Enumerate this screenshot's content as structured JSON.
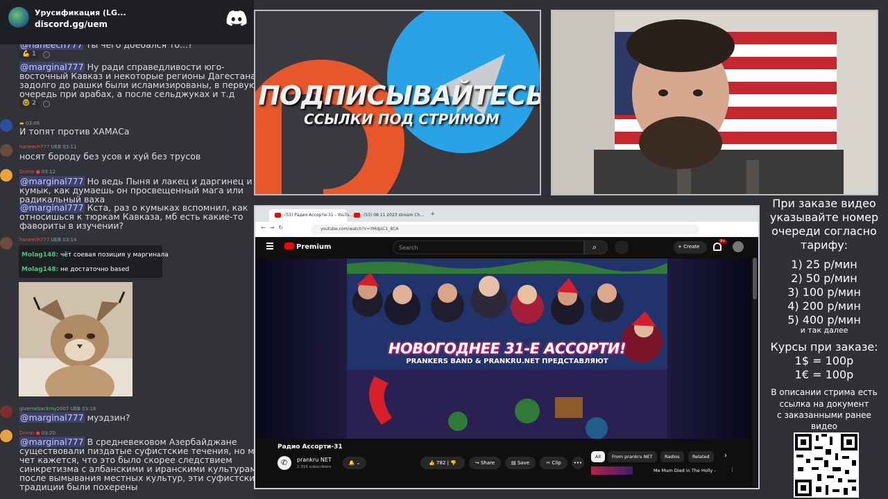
{
  "discord": {
    "server_name": "Урусификация (LG...",
    "invite": "discord.gg/uem"
  },
  "chat": {
    "m0_text": "ты чего доебался то...?",
    "m0_mention": "@haneech777",
    "m0_react": "1",
    "m1_mention": "@marginal777",
    "m1_lines": [
      "Ну ради справедливости юго-",
      "восточный Кавказ и некоторые регионы Дагестана",
      "задолго до рашки были исламизированы, в первую",
      "очередь при арабах, а после сельджуках и т.д"
    ],
    "m1_react": "2",
    "m2_time": "03:08",
    "m2_text": "И топят против ХАМАСа",
    "m3_user": "haneech777",
    "m3_badge": "UEB",
    "m3_time": "03:11",
    "m3_text": "носят бороду без усов и хуй без трусов",
    "m4_user": "Drimo",
    "m4_time": "03:12",
    "m4_mention": "@marginal777",
    "m4_lines": [
      "Но ведь Пыня и лакец и даргинец и",
      "кумык, как думаешь он просвещенный мага или",
      "радикальный ваха"
    ],
    "m5_mention": "@marginal777",
    "m5_lines": [
      "Кста, раз о кумыках вспомнил, как",
      "относишься к тюркам Кавказа, мб есть какие-то",
      "фавориты в изучении?"
    ],
    "m6_user": "haneech777",
    "m6_badge": "UEB",
    "m6_time": "03:14",
    "quote1_user": "Molag148:",
    "quote1_text": "чёт соевая позиция у маргинала",
    "quote2_user": "Molag148:",
    "quote2_text": "не достаточно based",
    "m7_user": "givemebackmy2007",
    "m7_badge": "UEB",
    "m7_time": "03:18",
    "m7_mention": "@marginal777",
    "m7_text": "муэдзин?",
    "m8_user": "Drimo",
    "m8_time": "03:20",
    "m8_mention": "@marginal777",
    "m8_lines": [
      "В средневековом Азербайджане",
      "существовали пиздатые суфистские течения, но мне",
      "чет кажется, что это было скорее следствием",
      "синкретизма с албанскими и иранскими культурами, и",
      "после вымывания местных культур, эти суфистские",
      "традиции были похерены"
    ]
  },
  "promo": {
    "title": "ПОДПИСЫВАЙТЕСЬ",
    "subtitle": "ССЫЛКИ ПОД СТРИМОМ"
  },
  "browser": {
    "tab1": "(53) Радио Ассорти-31 - YouTu...",
    "tab2": "(53) 08 11 2023 stream Ch...",
    "url": "youtube.com/watch?v=YMdpiC1_8CA",
    "logo": "Premium",
    "search_placeholder": "Search",
    "create": "Create",
    "notif_badge": "9+",
    "video_big_title": "НОВОГОДНЕЕ 31-Е АССОРТИ!",
    "video_sub_title": "PRANKERS BAND & PRANKRU.NET ПРЕДСТАВЛЯЮТ",
    "video_title": "Радио Ассорти-31",
    "channel": "prankru NET",
    "subscribers": "2.31K subscribers",
    "likes": "782",
    "share": "Share",
    "save": "Save",
    "clip": "Clip",
    "more": "•••",
    "chips": [
      "All",
      "From prankru NET",
      "Radios",
      "Related"
    ],
    "rec_title": "Me Mum Died in The Holly -"
  },
  "pricing": {
    "intro": [
      "При заказе видео",
      "указывайте номер",
      "очереди согласно",
      "тарифу:"
    ],
    "tiers": [
      "1) 25 р/мин",
      "2) 50 р/мин",
      "3) 100 р/мин",
      "4) 200 р/мин",
      "5) 400 р/мин"
    ],
    "etc": "и так далее",
    "rates_title": "Курсы при заказе:",
    "rate_usd": "1$ = 100р",
    "rate_eur": "1€ = 100р",
    "doc_note": [
      "В описании стрима есть",
      "ссылка на документ",
      "с заказанными ранее",
      "видео"
    ]
  },
  "colors": {
    "discord_bg": "#313338",
    "mention_bg": "#3c4270",
    "youtube_red": "#ff0000",
    "telegram_blue": "#2aa3e6",
    "boosty_orange": "#e8562b"
  }
}
